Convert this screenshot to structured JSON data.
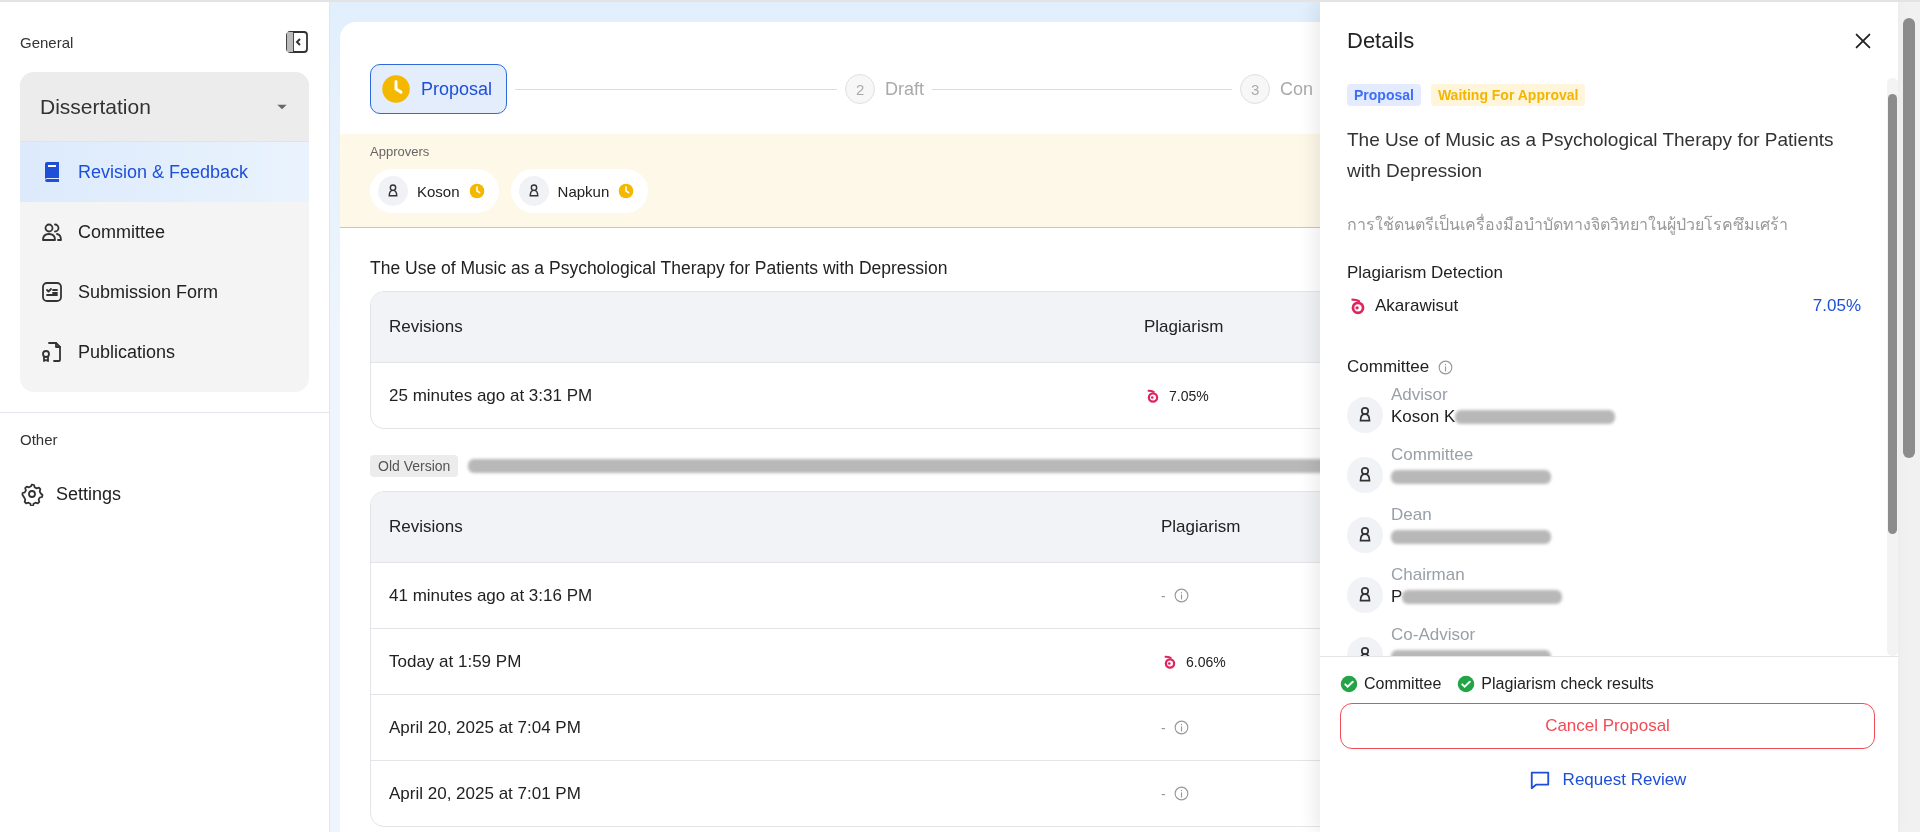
{
  "sidebar": {
    "general_label": "General",
    "group": {
      "label": "Dissertation",
      "expanded": true,
      "items": [
        {
          "label": "Revision & Feedback",
          "selected": true
        },
        {
          "label": "Committee",
          "selected": false
        },
        {
          "label": "Submission Form",
          "selected": false
        },
        {
          "label": "Publications",
          "selected": false
        }
      ]
    },
    "other_label": "Other",
    "other_items": [
      {
        "label": "Settings",
        "selected": false
      }
    ]
  },
  "stepper": {
    "steps": [
      {
        "label": "Proposal",
        "selected": true
      },
      {
        "label": "Draft",
        "number": "2",
        "selected": false
      },
      {
        "label": "Con",
        "number": "3",
        "selected": false
      }
    ]
  },
  "approvers": {
    "label": "Approvers",
    "people": [
      {
        "name": "Koson",
        "pending": true
      },
      {
        "name": "Napkun",
        "pending": true
      }
    ]
  },
  "current": {
    "title": "The Use of Music as a Psychological Therapy for Patients with Depression",
    "table": {
      "columns": [
        "Revisions",
        "Plagiarism"
      ],
      "rows": [
        {
          "date": "25 minutes ago at 3:31 PM",
          "kind": "score",
          "plagiarism": "7.05%"
        }
      ]
    }
  },
  "old_version": {
    "badge": "Old Version",
    "title_redacted": true,
    "table": {
      "columns": [
        "Revisions",
        "Plagiarism"
      ],
      "rows": [
        {
          "date": "41 minutes ago at 3:16 PM",
          "kind": "none",
          "plagiarism": "-"
        },
        {
          "date": "Today at 1:59 PM",
          "kind": "score",
          "plagiarism": "6.06%"
        },
        {
          "date": "April 20, 2025 at 7:04 PM",
          "kind": "none",
          "plagiarism": "-"
        },
        {
          "date": "April 20, 2025 at 7:01 PM",
          "kind": "none",
          "plagiarism": "-"
        }
      ]
    }
  },
  "details": {
    "title": "Details",
    "badges": [
      {
        "label": "Proposal",
        "color": "#3b6ff5"
      },
      {
        "label": "Waiting For Approval",
        "color": "#f5b400"
      }
    ],
    "thesis_title": "The Use of Music as a Psychological Therapy for Patients with Depression",
    "thesis_title_th": "การใช้ดนตรีเป็นเครื่องมือบำบัดทางจิตวิทยาในผู้ป่วยโรคซึมเศร้า",
    "plagiarism": {
      "heading": "Plagiarism Detection",
      "checker": "Akarawisut",
      "score": "7.05%"
    },
    "committee": {
      "heading": "Committee",
      "members": [
        {
          "role": "Advisor",
          "name": "Koson K",
          "redacted": true
        },
        {
          "role": "Committee",
          "redacted": true
        },
        {
          "role": "Dean",
          "redacted": true
        },
        {
          "role": "Chairman",
          "name": "P",
          "redacted": true
        },
        {
          "role": "Co-Advisor",
          "redacted": true
        }
      ]
    },
    "checks": [
      {
        "label": "Committee",
        "done": true
      },
      {
        "label": "Plagiarism check results",
        "done": true
      }
    ],
    "cancel_button": "Cancel Proposal",
    "review_link": "Request Review"
  }
}
